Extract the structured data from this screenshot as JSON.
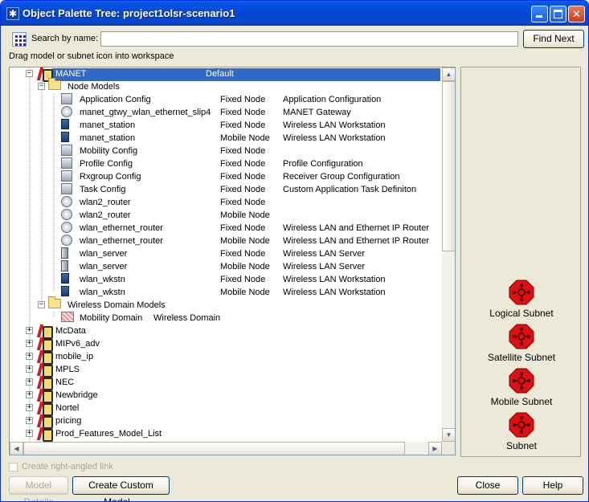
{
  "window": {
    "title": "Object Palette Tree: project1olsr-scenario1",
    "icon": "palette-icon"
  },
  "search": {
    "label": "Search by name:",
    "value": "",
    "find_next": "Find Next"
  },
  "hint": "Drag model or subnet icon into workspace",
  "tree": {
    "selected": {
      "name": "MANET",
      "col2": "Default"
    },
    "node_models_folder": "Node Models",
    "node_models": [
      {
        "name": "Application Config",
        "type": "Fixed Node",
        "desc": "Application Configuration",
        "icon": "config-icon"
      },
      {
        "name": "manet_gtwy_wlan_ethernet_slip4",
        "type": "Fixed Node",
        "desc": "MANET Gateway",
        "icon": "router-icon"
      },
      {
        "name": "manet_station",
        "type": "Fixed Node",
        "desc": "Wireless LAN Workstation",
        "icon": "station-icon"
      },
      {
        "name": "manet_station",
        "type": "Mobile Node",
        "desc": "Wireless LAN Workstation",
        "icon": "station-icon"
      },
      {
        "name": "Mobility Config",
        "type": "Fixed Node",
        "desc": "",
        "icon": "config-icon"
      },
      {
        "name": "Profile Config",
        "type": "Fixed Node",
        "desc": "Profile Configuration",
        "icon": "config-icon"
      },
      {
        "name": "Rxgroup Config",
        "type": "Fixed Node",
        "desc": "Receiver Group Configuration",
        "icon": "config-icon"
      },
      {
        "name": "Task Config",
        "type": "Fixed Node",
        "desc": "Custom Application Task Definiton",
        "icon": "config-icon"
      },
      {
        "name": "wlan2_router",
        "type": "Fixed Node",
        "desc": "",
        "icon": "router-icon"
      },
      {
        "name": "wlan2_router",
        "type": "Mobile Node",
        "desc": "",
        "icon": "router-icon"
      },
      {
        "name": "wlan_ethernet_router",
        "type": "Fixed Node",
        "desc": "Wireless LAN and Ethernet IP Router",
        "icon": "router-icon"
      },
      {
        "name": "wlan_ethernet_router",
        "type": "Mobile Node",
        "desc": "Wireless LAN and Ethernet IP Router",
        "icon": "router-icon"
      },
      {
        "name": "wlan_server",
        "type": "Fixed Node",
        "desc": "Wireless LAN Server",
        "icon": "server-icon"
      },
      {
        "name": "wlan_server",
        "type": "Mobile Node",
        "desc": "Wireless LAN Server",
        "icon": "server-icon"
      },
      {
        "name": "wlan_wkstn",
        "type": "Fixed Node",
        "desc": "Wireless LAN Workstation",
        "icon": "station-icon"
      },
      {
        "name": "wlan_wkstn",
        "type": "Mobile Node",
        "desc": "Wireless LAN Workstation",
        "icon": "station-icon"
      }
    ],
    "domain_folder": "Wireless Domain Models",
    "domain_models": [
      {
        "name": "Mobility Domain",
        "type": "Wireless Domain"
      }
    ],
    "libraries": [
      "McData",
      "MIPv6_adv",
      "mobile_ip",
      "MPLS",
      "NEC",
      "Newbridge",
      "Nortel",
      "pricing",
      "Prod_Features_Model_List"
    ]
  },
  "subnets": [
    {
      "label": "Logical Subnet",
      "color": "#e01010"
    },
    {
      "label": "Satellite Subnet",
      "color": "#e01010"
    },
    {
      "label": "Mobile Subnet",
      "color": "#e01010"
    },
    {
      "label": "Subnet",
      "color": "#e01010"
    }
  ],
  "footer": {
    "checkbox_label": "Create right-angled link",
    "model_details": "Model Details",
    "create_custom": "Create Custom Model...",
    "close": "Close",
    "help": "Help"
  }
}
